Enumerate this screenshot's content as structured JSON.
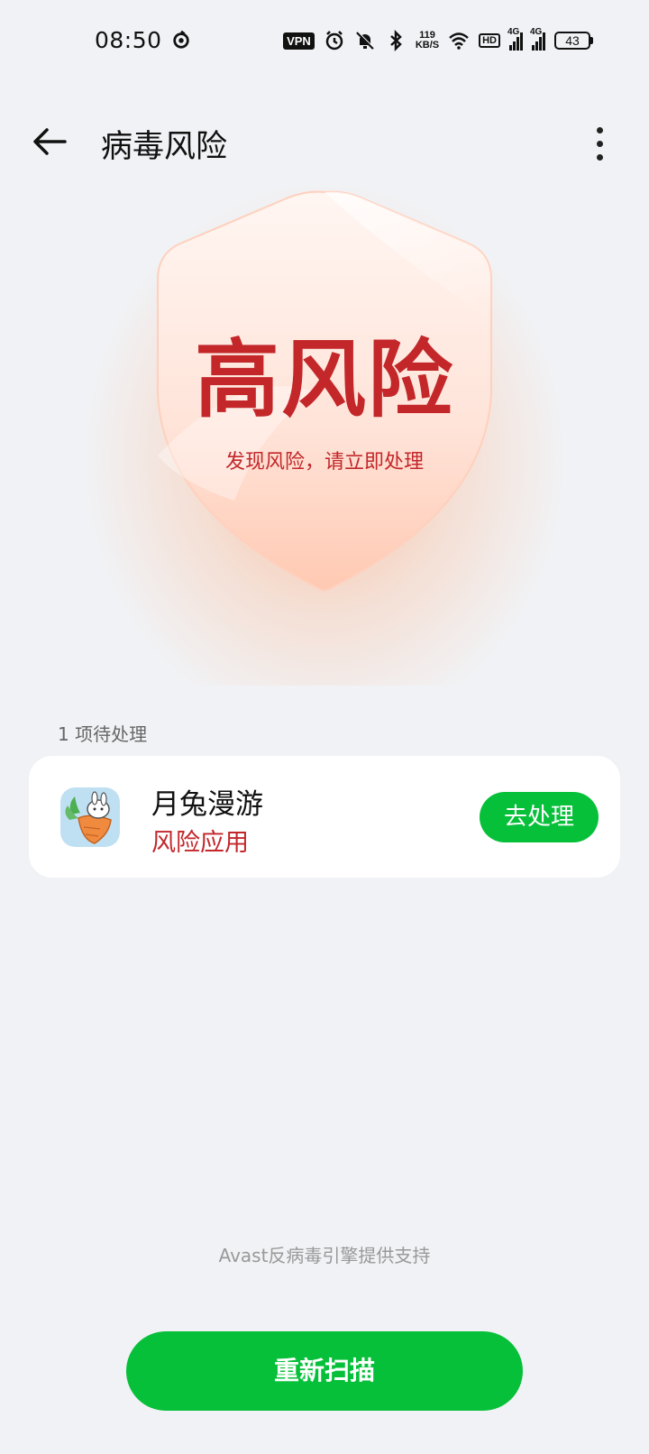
{
  "status_bar": {
    "time": "08:50",
    "vpn": "VPN",
    "net_speed_value": "119",
    "net_speed_unit": "KB/S",
    "hd": "HD",
    "signal1": "4G",
    "signal2": "4G",
    "battery": "43"
  },
  "header": {
    "title": "病毒风险"
  },
  "shield": {
    "title": "高风险",
    "subtitle": "发现风险，请立即处理",
    "accent_color": "#c3272a"
  },
  "section": {
    "label": "1 项待处理"
  },
  "risk_item": {
    "app_name": "月兔漫游",
    "status": "风险应用",
    "action_label": "去处理"
  },
  "footer": {
    "note": "Avast反病毒引擎提供支持",
    "rescan_label": "重新扫描"
  },
  "colors": {
    "primary_green": "#07c03a",
    "danger_red": "#c3272a",
    "background": "#f1f2f5"
  }
}
